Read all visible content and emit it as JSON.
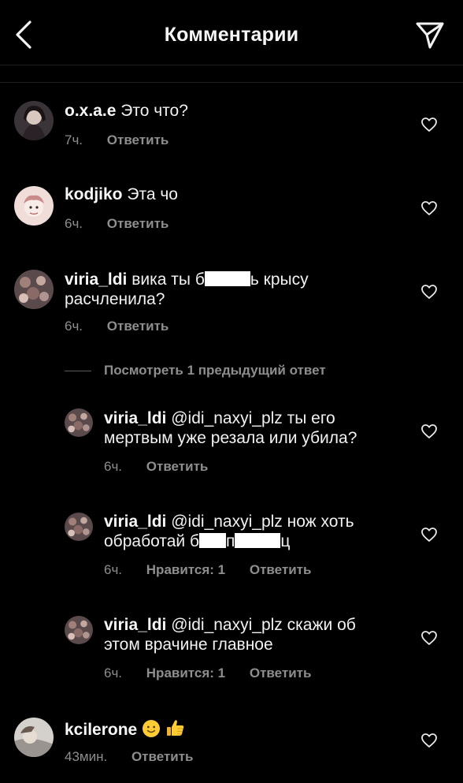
{
  "header": {
    "title": "Комментарии",
    "back_icon": "chevron-left-icon",
    "share_icon": "paper-plane-icon"
  },
  "comments": [
    {
      "user": "o.x.a.e",
      "text": "Это что?",
      "time": "7ч.",
      "reply": "Ответить"
    },
    {
      "user": "kodjiko",
      "text": "Эта чо",
      "time": "6ч.",
      "reply": "Ответить"
    },
    {
      "user": "viria_ldi",
      "text_part1": "вика ты б",
      "text_part2": "ь крысу",
      "text_line2": "расчленила?",
      "time": "6ч.",
      "reply": "Ответить"
    },
    {
      "user": "kcilerone",
      "text": "",
      "time": "43мин.",
      "reply": "Ответить"
    }
  ],
  "view_previous": "Посмотреть 1 предыдущий ответ",
  "replies": [
    {
      "user": "viria_ldi",
      "line1": "@idi_naxyi_plz ты его",
      "line2": "мертвым уже резала или убила?",
      "time": "6ч.",
      "reply": "Ответить"
    },
    {
      "user": "viria_ldi",
      "line1": "@idi_naxyi_plz нож хоть",
      "line2_a": "обработай б",
      "line2_b": "п",
      "line2_c": "ц",
      "time": "6ч.",
      "likes": "Нравится: 1",
      "reply": "Ответить"
    },
    {
      "user": "viria_ldi",
      "line1": "@idi_naxyi_plz скажи об",
      "line2": "этом врачине главное",
      "time": "6ч.",
      "likes": "Нравится: 1",
      "reply": "Ответить"
    }
  ],
  "colors": {
    "background": "#000000",
    "text": "#f2f2f2",
    "meta": "#8e8e8e"
  }
}
